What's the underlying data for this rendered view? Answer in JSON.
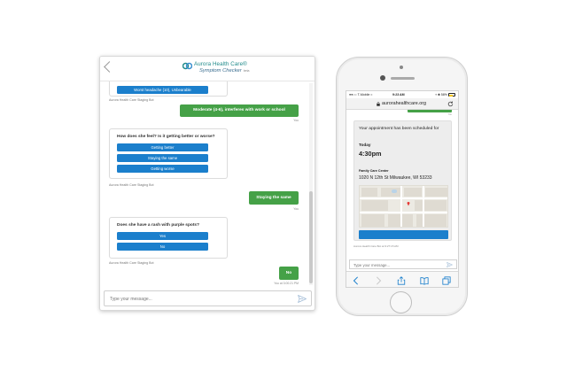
{
  "desktop": {
    "logo": {
      "title": "Aurora Health Care",
      "reg": "®",
      "subtitle": "Symptom Checker",
      "beta": "beta"
    },
    "messages": [
      {
        "type": "partial_option",
        "label": "Worst headache (10), Unbearable"
      },
      {
        "type": "bot_label",
        "text": "Aurora Health Care Staging Bot"
      },
      {
        "type": "user",
        "text": "Moderate (4-6), interferes with work or school",
        "meta": "You"
      },
      {
        "type": "bot_card",
        "question": "How does she feel? Is it getting better or worse?",
        "options": [
          "Getting better",
          "Staying the same",
          "Getting worse"
        ],
        "label": "Aurora Health Care Staging Bot"
      },
      {
        "type": "user",
        "text": "Staying the same",
        "meta": "You"
      },
      {
        "type": "bot_card",
        "question": "Does she have a rash with purple spots?",
        "options": [
          "Yes",
          "No"
        ],
        "label": "Aurora Health Care Staging Bot"
      },
      {
        "type": "user",
        "text": "No",
        "meta": "You at 3:00:21 PM"
      }
    ],
    "input": {
      "placeholder": "Type your message..."
    }
  },
  "phone": {
    "status": {
      "carrier": "T-Mobile",
      "time": "9:23 AM",
      "battery": "58%"
    },
    "url": "aurorahealthcare.org",
    "sliver_meta": "You",
    "appointment": {
      "scheduled_text": "Your appointment has been scheduled for",
      "day": "Today",
      "time": "4:30pm",
      "place": "Family Care Center",
      "address": "1020 N 12th St Milwaukee, WI 53233"
    },
    "bot_label": "Aurora Health Care Bot at 9:27:15 AM",
    "input": {
      "placeholder": "Type your message..."
    }
  },
  "colors": {
    "primary_blue": "#1b7fcc",
    "user_green": "#45a147",
    "brand_teal": "#1f8a8a"
  }
}
